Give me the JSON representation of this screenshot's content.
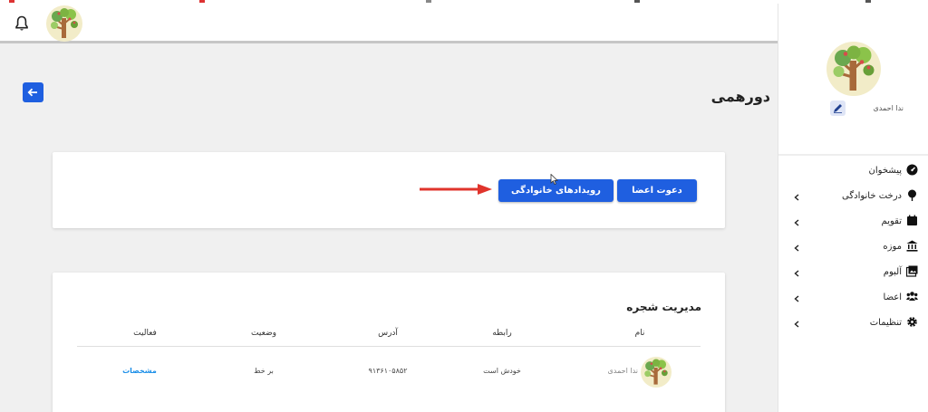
{
  "header": {
    "notifications_icon": "bell-icon"
  },
  "page": {
    "title": "دورهمی",
    "back_icon": "arrow-left-icon"
  },
  "profile": {
    "name": "ندا احمدی",
    "edit_icon": "pencil-icon"
  },
  "sidebar": {
    "items": [
      {
        "label": "پیشخوان",
        "icon": "dashboard-gauge-icon",
        "has_chevron": false
      },
      {
        "label": "درخت خانوادگی",
        "icon": "tree-icon",
        "has_chevron": true
      },
      {
        "label": "تقویم",
        "icon": "calendar-icon",
        "has_chevron": true
      },
      {
        "label": "موزه",
        "icon": "museum-icon",
        "has_chevron": true
      },
      {
        "label": "آلبوم",
        "icon": "photo-album-icon",
        "has_chevron": true
      },
      {
        "label": "اعضا",
        "icon": "users-icon",
        "has_chevron": true
      },
      {
        "label": "تنظیمات",
        "icon": "gear-icon",
        "has_chevron": true
      }
    ]
  },
  "actions": {
    "invite_label": "دعوت اعضا",
    "events_label": "رویدادهای خانوادگی"
  },
  "tree_management": {
    "title": "مدیریت شجره",
    "columns": {
      "name": "نام",
      "relation": "رابطه",
      "address": "آدرس",
      "status": "وضعیت",
      "activity": "فعالیت"
    },
    "rows": [
      {
        "name": "ندا احمدی",
        "relation": "خودش است",
        "address": "۹۱۳۶۱۰۵۸۵۲",
        "status": "بر خط",
        "activity": "مشخصات"
      }
    ]
  },
  "colors": {
    "primary": "#1f5fe0",
    "link": "#1a8ee8",
    "annotation_arrow": "#e0342c"
  }
}
